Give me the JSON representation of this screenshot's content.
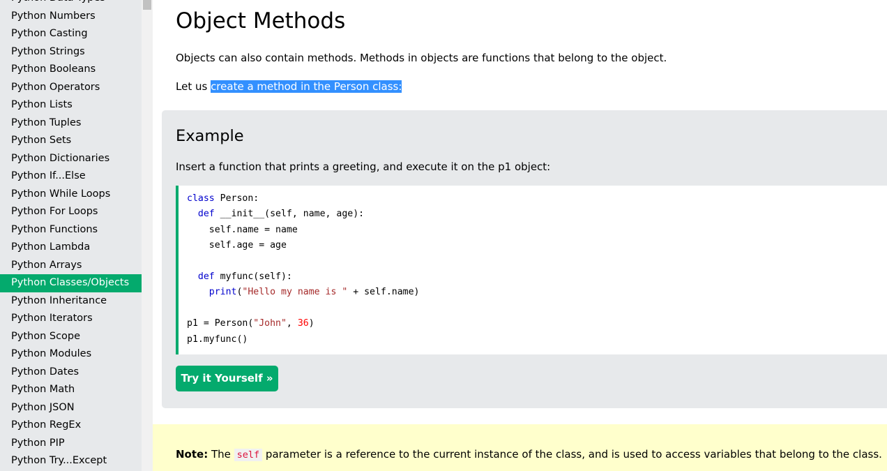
{
  "sidebar": {
    "items": [
      {
        "label": "Python Data Types"
      },
      {
        "label": "Python Numbers"
      },
      {
        "label": "Python Casting"
      },
      {
        "label": "Python Strings"
      },
      {
        "label": "Python Booleans"
      },
      {
        "label": "Python Operators"
      },
      {
        "label": "Python Lists"
      },
      {
        "label": "Python Tuples"
      },
      {
        "label": "Python Sets"
      },
      {
        "label": "Python Dictionaries"
      },
      {
        "label": "Python If...Else"
      },
      {
        "label": "Python While Loops"
      },
      {
        "label": "Python For Loops"
      },
      {
        "label": "Python Functions"
      },
      {
        "label": "Python Lambda"
      },
      {
        "label": "Python Arrays"
      },
      {
        "label": "Python Classes/Objects",
        "active": true
      },
      {
        "label": "Python Inheritance"
      },
      {
        "label": "Python Iterators"
      },
      {
        "label": "Python Scope"
      },
      {
        "label": "Python Modules"
      },
      {
        "label": "Python Dates"
      },
      {
        "label": "Python Math"
      },
      {
        "label": "Python JSON"
      },
      {
        "label": "Python RegEx"
      },
      {
        "label": "Python PIP"
      },
      {
        "label": "Python Try...Except"
      }
    ]
  },
  "main": {
    "title": "Object Methods",
    "intro": "Objects can also contain methods. Methods in objects are functions that belong to the object.",
    "lead_prefix": "Let us ",
    "lead_selected": "create a method in the Person class:",
    "example": {
      "title": "Example",
      "description": "Insert a function that prints a greeting, and execute it on the p1 object:",
      "code_lines": [
        [
          {
            "t": "class",
            "c": "kw"
          },
          {
            "t": " Person:"
          }
        ],
        [
          {
            "t": "  "
          },
          {
            "t": "def",
            "c": "kw"
          },
          {
            "t": " __init__(self, name, age):"
          }
        ],
        [
          {
            "t": "    self.name = name"
          }
        ],
        [
          {
            "t": "    self.age = age"
          }
        ],
        [
          {
            "t": ""
          }
        ],
        [
          {
            "t": "  "
          },
          {
            "t": "def",
            "c": "kw"
          },
          {
            "t": " myfunc(self):"
          }
        ],
        [
          {
            "t": "    "
          },
          {
            "t": "print",
            "c": "kw"
          },
          {
            "t": "("
          },
          {
            "t": "\"Hello my name is \"",
            "c": "str"
          },
          {
            "t": " + self.name)"
          }
        ],
        [
          {
            "t": ""
          }
        ],
        [
          {
            "t": "p1 = Person("
          },
          {
            "t": "\"John\"",
            "c": "str"
          },
          {
            "t": ", "
          },
          {
            "t": "36",
            "c": "num"
          },
          {
            "t": ")"
          }
        ],
        [
          {
            "t": "p1.myfunc()"
          }
        ]
      ],
      "button_label": "Try it Yourself »"
    },
    "note": {
      "label": "Note:",
      "before": " The ",
      "code": "self",
      "after": " parameter is a reference to the current instance of the class, and is used to access variables that belong to the class."
    }
  },
  "colors": {
    "accent": "#04aa6d",
    "sidebar_bg": "#e7e9eb",
    "selection": "#3390ff",
    "note_bg": "#ffffcc",
    "keyword": "#0000cd",
    "string": "#a52a2a",
    "number": "#ff0000"
  }
}
